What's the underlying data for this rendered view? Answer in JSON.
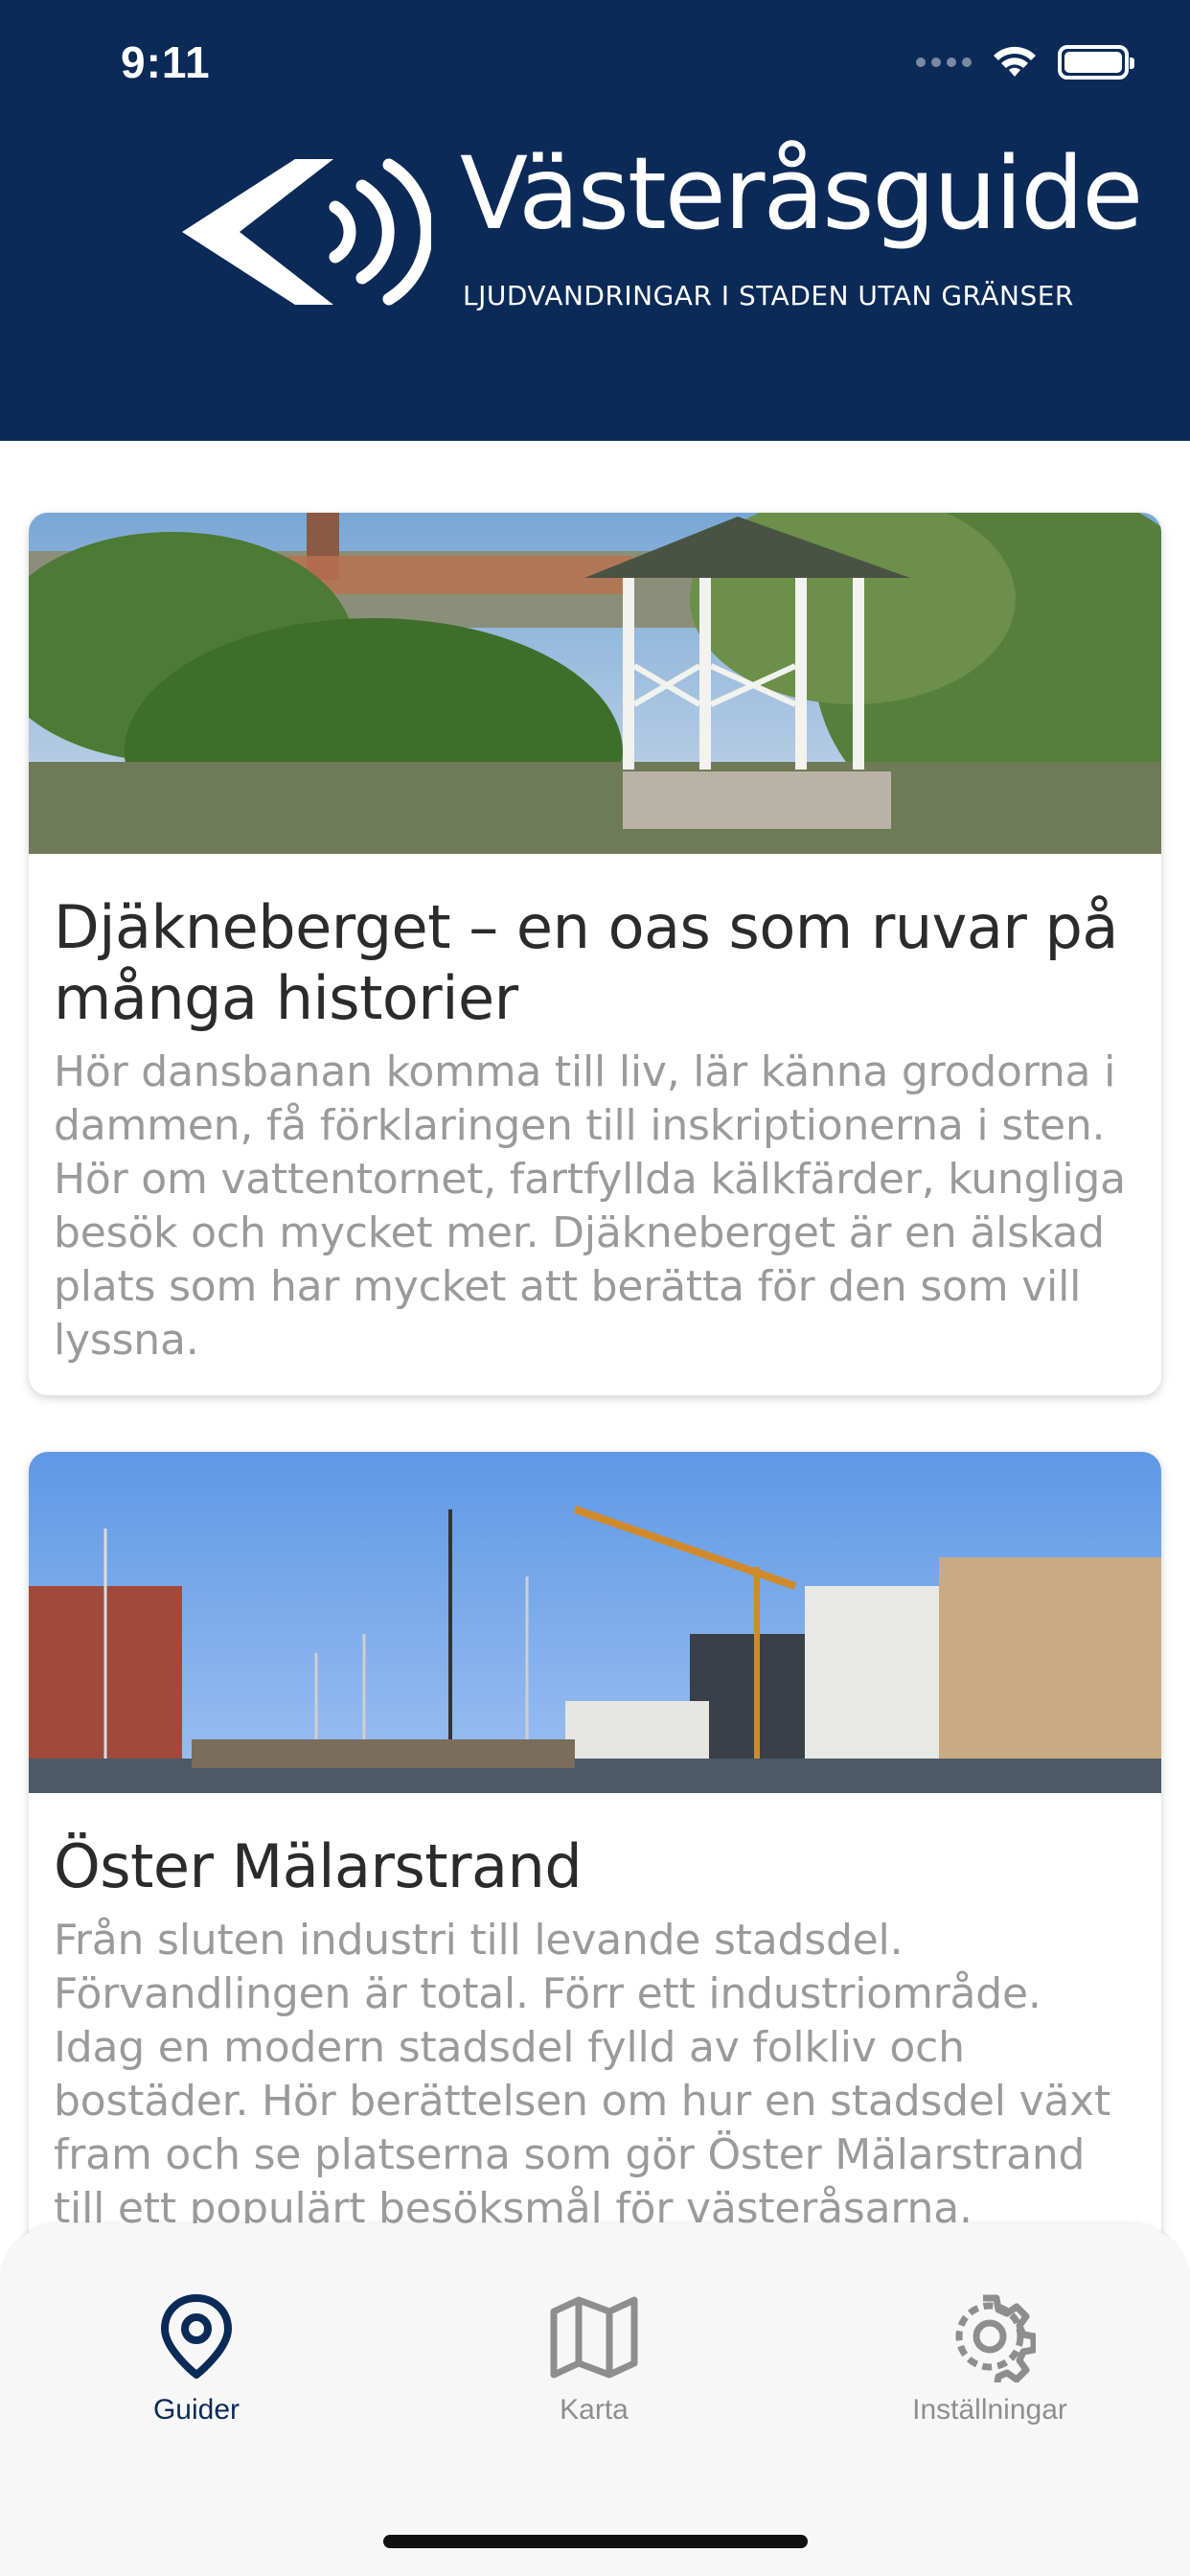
{
  "status_bar": {
    "time": "9:11"
  },
  "header": {
    "title": "Västeråsguide",
    "subtitle": "LJUDVANDRINGAR I STADEN UTAN GRÄNSER",
    "logo_icon": "sound-arrow-logo-icon",
    "background": "#0b2a57"
  },
  "guides": [
    {
      "title": "Djäkneberget – en oas som ruvar på många historier",
      "description": "Hör dansbanan komma till liv, lär känna grodorna i dammen, få förklaringen till inskriptionerna i sten. Hör om vattentornet, fartfyllda kälkfärder, kungliga besök och mycket mer. Djäkneberget är en älskad plats som har mycket att berätta för den som vill lyssna.",
      "image": "gazebo-park-photo"
    },
    {
      "title": "Öster Mälarstrand",
      "description": "Från sluten industri till levande stadsdel. Förvandlingen är total. Förr ett industriområde. Idag en modern stadsdel fylld av folkliv och bostäder.  Hör berättelsen om hur en stadsdel växt fram och se platserna som gör Öster Mälarstrand till ett populärt besöksmål för västeråsarna.",
      "image": "harbor-marina-photo"
    }
  ],
  "tabbar": {
    "tabs": [
      {
        "label": "Guider",
        "icon": "location-pin-icon",
        "active": true
      },
      {
        "label": "Karta",
        "icon": "map-icon",
        "active": false
      },
      {
        "label": "Inställningar",
        "icon": "gear-icon",
        "active": false
      }
    ],
    "active_color": "#0b2a57",
    "inactive_color": "#8e8e8e"
  }
}
